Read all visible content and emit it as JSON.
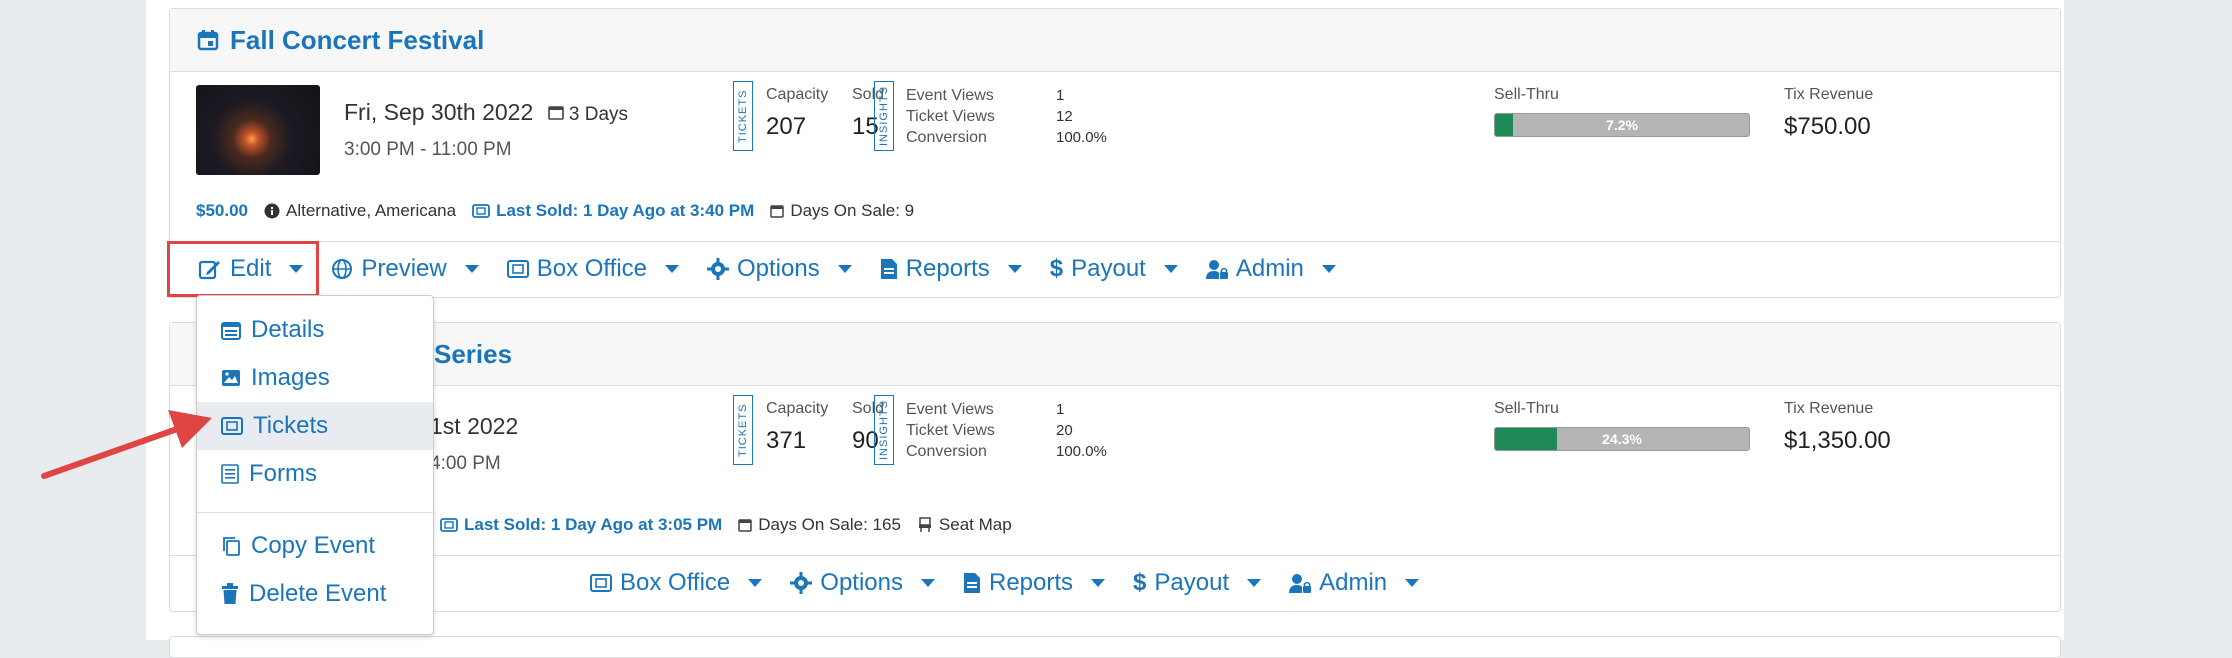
{
  "events": [
    {
      "title": "Fall Concert Festival",
      "date": "Fri, Sep 30th 2022",
      "days": "3 Days",
      "time": "3:00 PM - 11:00 PM",
      "tickets_label": "TICKETS",
      "insights_label": "INSIGHTS",
      "capacity_label": "Capacity",
      "capacity": "207",
      "sold_label": "Sold",
      "sold": "15",
      "event_views_label": "Event Views",
      "event_views": "1",
      "ticket_views_label": "Ticket Views",
      "ticket_views": "12",
      "conversion_label": "Conversion",
      "conversion": "100.0%",
      "sell_thru_label": "Sell-Thru",
      "sell_thru": "7.2%",
      "sell_thru_fraction": 0.072,
      "revenue_label": "Tix Revenue",
      "revenue": "$750.00",
      "price": "$50.00",
      "genre": "Alternative, Americana",
      "last_sold": "Last Sold: 1 Day Ago at 3:40 PM",
      "days_on_sale": "Days On Sale: 9"
    },
    {
      "title": "Series",
      "date": "1st 2022",
      "time": "4:00 PM",
      "tickets_label": "TICKETS",
      "insights_label": "INSIGHTS",
      "capacity_label": "Capacity",
      "capacity": "371",
      "sold_label": "Sold",
      "sold": "90",
      "event_views_label": "Event Views",
      "event_views": "1",
      "ticket_views_label": "Ticket Views",
      "ticket_views": "20",
      "conversion_label": "Conversion",
      "conversion": "100.0%",
      "sell_thru_label": "Sell-Thru",
      "sell_thru": "24.3%",
      "sell_thru_fraction": 0.243,
      "revenue_label": "Tix Revenue",
      "revenue": "$1,350.00",
      "last_sold": "Last Sold: 1 Day Ago at 3:05 PM",
      "days_on_sale": "Days On Sale: 165",
      "seat_map": "Seat Map"
    }
  ],
  "actions": {
    "edit": "Edit",
    "preview": "Preview",
    "box_office": "Box Office",
    "options": "Options",
    "reports": "Reports",
    "payout": "Payout",
    "admin": "Admin"
  },
  "edit_menu": {
    "details": "Details",
    "images": "Images",
    "tickets": "Tickets",
    "forms": "Forms",
    "copy_event": "Copy Event",
    "delete_event": "Delete Event"
  },
  "colors": {
    "accent": "#1b75bb",
    "bar_fill": "#1e8a57",
    "highlight": "#e04545"
  }
}
